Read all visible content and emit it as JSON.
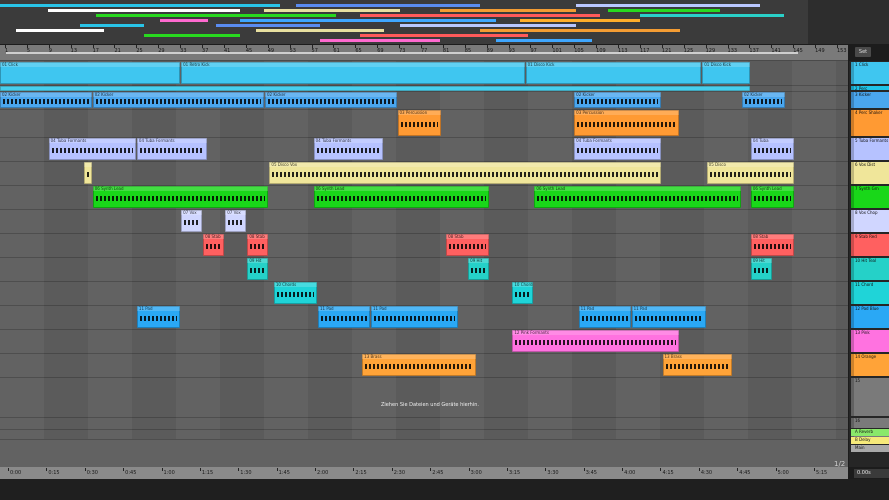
{
  "overview": {
    "bars": [
      {
        "color": "#29c4e8",
        "w": 1
      },
      {
        "color": "#5a8cf0",
        "w": 1
      },
      {
        "color": "#b9c7ff",
        "w": 1
      },
      {
        "color": "#ffffff",
        "w": 1
      },
      {
        "color": "#e8e0a0",
        "w": 1
      },
      {
        "color": "#f39c33",
        "w": 1
      },
      {
        "color": "#28d91f",
        "w": 1
      },
      {
        "color": "#ff5a5a",
        "w": 1
      },
      {
        "color": "#2ad0c8",
        "w": 1
      },
      {
        "color": "#ff6ad0",
        "w": 1
      },
      {
        "color": "#3fa7ff",
        "w": 1
      },
      {
        "color": "#ffae2a",
        "w": 1
      }
    ]
  },
  "ruler": {
    "beats": [
      "1",
      "5",
      "9",
      "13",
      "17",
      "21",
      "25",
      "29",
      "33",
      "37",
      "41",
      "45",
      "49",
      "53",
      "57",
      "61",
      "65",
      "69",
      "73",
      "77",
      "81",
      "85",
      "89",
      "93",
      "97",
      "101",
      "105",
      "109",
      "113",
      "117",
      "121",
      "125",
      "129",
      "133",
      "137",
      "141",
      "145",
      "149",
      "153"
    ],
    "times": [
      "0:00",
      "0:15",
      "0:30",
      "0:45",
      "1:00",
      "1:15",
      "1:30",
      "1:45",
      "2:00",
      "2:15",
      "2:30",
      "2:45",
      "3:00",
      "3:15",
      "3:30",
      "3:45",
      "4:00",
      "4:15",
      "4:30",
      "4:45",
      "5:00",
      "5:15"
    ],
    "set_label": "Set",
    "page_indicator": "1/2"
  },
  "center_hint": "Ziehen Sie Dateien und Geräte hierhin.",
  "tempo": "0.00s",
  "tracks": [
    {
      "name": "1 Click",
      "color": "#3fc6f0",
      "clips": [
        {
          "label": "01 Click",
          "s": 0,
          "e": 20.5,
          "wave": false
        },
        {
          "label": "01 Retro Kick",
          "s": 20.5,
          "e": 59.5,
          "wave": false
        },
        {
          "label": "01 Disco Kick",
          "s": 59.5,
          "e": 79.5,
          "wave": false
        },
        {
          "label": "01 Disco Kick",
          "s": 79.5,
          "e": 85,
          "wave": false
        }
      ]
    },
    {
      "name": "2 Perc",
      "color": "#1fc4e8",
      "clips": [
        {
          "label": "",
          "s": 0,
          "e": 85,
          "wave": false,
          "thin": true
        }
      ]
    },
    {
      "name": "3 Kicker",
      "color": "#4aa6ee",
      "clips": [
        {
          "label": "02 Kicker",
          "s": 0,
          "e": 10.5,
          "wave": true
        },
        {
          "label": "02 Kicker",
          "s": 10.5,
          "e": 30,
          "wave": true
        },
        {
          "label": "02 Kicker",
          "s": 30,
          "e": 45,
          "wave": true
        },
        {
          "label": "02 Kicker",
          "s": 65,
          "e": 75,
          "wave": true
        },
        {
          "label": "02 Kicker",
          "s": 84,
          "e": 89,
          "wave": true
        }
      ]
    },
    {
      "name": "4 Perc Shaker",
      "color": "#ff9a33",
      "clips": [
        {
          "label": "03 Percussion",
          "s": 45,
          "e": 50,
          "wave": true
        },
        {
          "label": "03 Percussion",
          "s": 65,
          "e": 77,
          "wave": true
        }
      ]
    },
    {
      "name": "5 Tuba Formants",
      "color": "#b6c2ff",
      "clips": [
        {
          "label": "04 Tuba Formants",
          "s": 5.5,
          "e": 15.5,
          "wave": true
        },
        {
          "label": "04 Tuba Formants",
          "s": 15.5,
          "e": 23.5,
          "wave": true
        },
        {
          "label": "04 Tuba Formants",
          "s": 35.5,
          "e": 43.5,
          "wave": true
        },
        {
          "label": "04 Tuba Formants",
          "s": 65,
          "e": 75,
          "wave": true
        },
        {
          "label": "04 Tuba",
          "s": 85,
          "e": 90,
          "wave": true
        }
      ]
    },
    {
      "name": "6 Vox Dist",
      "color": "#f0e69a",
      "clips": [
        {
          "label": "",
          "s": 9.5,
          "e": 10.5,
          "wave": true
        },
        {
          "label": "05 Disco Vox",
          "s": 30.5,
          "e": 75,
          "wave": true
        },
        {
          "label": "05 Disco",
          "s": 80,
          "e": 90,
          "wave": true
        }
      ]
    },
    {
      "name": "7 Synth Grn",
      "color": "#19d719",
      "clips": [
        {
          "label": "06 Synth Lead",
          "s": 10.5,
          "e": 30.5,
          "wave": true
        },
        {
          "label": "06 Synth Lead",
          "s": 35.5,
          "e": 55.5,
          "wave": true
        },
        {
          "label": "06 Synth Lead",
          "s": 60.5,
          "e": 84,
          "wave": true
        },
        {
          "label": "06 Synth Lead",
          "s": 85,
          "e": 90,
          "wave": true
        }
      ]
    },
    {
      "name": "8 Vox Chop",
      "color": "#d0d6ff",
      "clips": [
        {
          "label": "07 Vox",
          "s": 20.5,
          "e": 23,
          "wave": true
        },
        {
          "label": "07 Vox",
          "s": 25.5,
          "e": 28,
          "wave": true
        }
      ]
    },
    {
      "name": "9 Stab Red",
      "color": "#ff6060",
      "clips": [
        {
          "label": "08 Stab",
          "s": 23,
          "e": 25.5,
          "wave": true
        },
        {
          "label": "08 Stab",
          "s": 28,
          "e": 30.5,
          "wave": true
        },
        {
          "label": "08 Stab",
          "s": 50.5,
          "e": 55.5,
          "wave": true
        },
        {
          "label": "08 Stab",
          "s": 85,
          "e": 90,
          "wave": true
        }
      ]
    },
    {
      "name": "10 Hit Teal",
      "color": "#25d1c8",
      "clips": [
        {
          "label": "09 Hit",
          "s": 28,
          "e": 30.5,
          "wave": true
        },
        {
          "label": "09 Hit",
          "s": 53,
          "e": 55.5,
          "wave": true
        },
        {
          "label": "09 Hit",
          "s": 85,
          "e": 87.5,
          "wave": true
        }
      ]
    },
    {
      "name": "11 Chord",
      "color": "#1fd4d8",
      "clips": [
        {
          "label": "10 Chords",
          "s": 31,
          "e": 36,
          "wave": true
        },
        {
          "label": "10 Chords",
          "s": 58,
          "e": 60.5,
          "wave": true
        }
      ]
    },
    {
      "name": "12 Pad Blue",
      "color": "#2aa8f5",
      "clips": [
        {
          "label": "11 Pad",
          "s": 15.5,
          "e": 20.5,
          "wave": true
        },
        {
          "label": "11 Pad",
          "s": 36,
          "e": 42,
          "wave": true
        },
        {
          "label": "11 Pad",
          "s": 42,
          "e": 52,
          "wave": true
        },
        {
          "label": "11 Pad",
          "s": 65.5,
          "e": 71.5,
          "wave": true
        },
        {
          "label": "11 Pad",
          "s": 71.5,
          "e": 80,
          "wave": true
        }
      ]
    },
    {
      "name": "13 Pink",
      "color": "#ff72e0",
      "clips": [
        {
          "label": "12 Pink Formants",
          "s": 58,
          "e": 77,
          "wave": true
        }
      ]
    },
    {
      "name": "14 Orange",
      "color": "#ffa338",
      "clips": [
        {
          "label": "13 Brass",
          "s": 41,
          "e": 54,
          "wave": true
        },
        {
          "label": "13 Brass",
          "s": 75,
          "e": 83,
          "wave": true
        }
      ]
    },
    {
      "name": "15",
      "color": "#7a7a7a",
      "clips": []
    },
    {
      "name": "16",
      "color": "#7a7a7a",
      "clips": []
    },
    {
      "name": "17",
      "color": "#7a7a7a",
      "clips": []
    }
  ],
  "returns": [
    {
      "name": "A Reverb",
      "color": "#89e86a"
    },
    {
      "name": "B Delay",
      "color": "#f6e97a"
    },
    {
      "name": "Main",
      "color": "#a9a9a9"
    }
  ]
}
